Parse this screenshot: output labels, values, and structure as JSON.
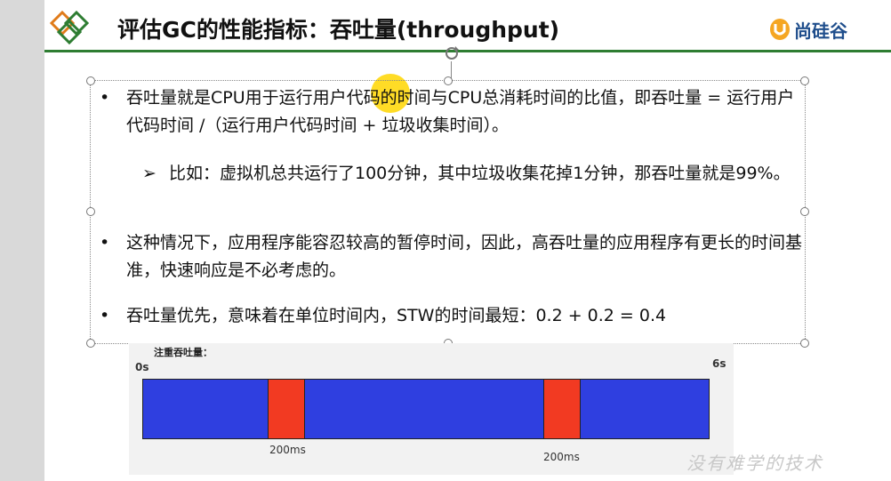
{
  "slide": {
    "title": "评估GC的性能指标：吞吐量(throughput)",
    "brand": {
      "name": "尚硅谷",
      "logo_icon": "u-logo-icon"
    }
  },
  "content": {
    "bullet1": "吞吐量就是CPU用于运行用户代码的时间与CPU总消耗时间的比值，即吞吐量 = 运行用户代码时间 /（运行用户代码时间 + 垃圾收集时间）。",
    "sub1": "比如：虚拟机总共运行了100分钟，其中垃圾收集花掉1分钟，那吞吐量就是99%。",
    "bullet2": "这种情况下，应用程序能容忍较高的暂停时间，因此，高吞吐量的应用程序有更长的时间基准，快速响应是不必考虑的。",
    "bullet3": "吞吐量优先，意味着在单位时间内，STW的时间最短：0.2 + 0.2 = 0.4"
  },
  "chart_data": {
    "type": "timeline",
    "title": "注重吞吐量：",
    "start_label": "0s",
    "end_label": "6s",
    "pauses": [
      {
        "label": "200ms"
      },
      {
        "label": "200ms"
      }
    ],
    "colors": {
      "running": "#2f3fe0",
      "pause": "#f23a22"
    }
  },
  "watermark": "没有难学的技术"
}
